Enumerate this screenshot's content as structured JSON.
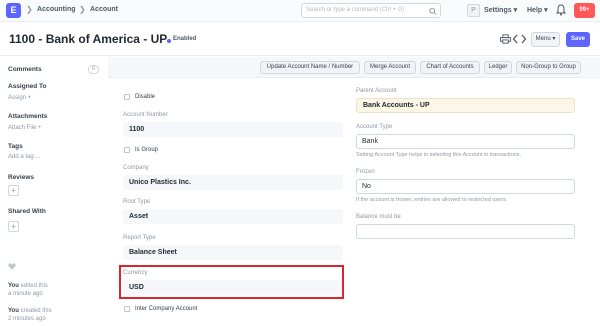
{
  "navbar": {
    "logo": "E",
    "breadcrumbs": [
      "Accounting",
      "Account"
    ],
    "search_placeholder": "Search or type a command (Ctrl + G)",
    "user_initial": "P",
    "settings_label": "Settings",
    "help_label": "Help",
    "notifications_count": "99+"
  },
  "titlebar": {
    "title": "1100 - Bank of America - UP",
    "status": "Enabled",
    "menu_label": "Menu",
    "save_label": "Save"
  },
  "sidebar": {
    "comments_label": "Comments",
    "comments_count": "0",
    "assigned_label": "Assigned To",
    "assign_link": "Assign +",
    "attachments_label": "Attachments",
    "attach_link": "Attach File +",
    "tags_label": "Tags",
    "add_tag_link": "Add a tag ...",
    "reviews_label": "Reviews",
    "shared_label": "Shared With",
    "plus": "+",
    "activity": [
      {
        "who": "You",
        "action": " edited this",
        "when": "a minute ago"
      },
      {
        "who": "You",
        "action": " created this",
        "when": "2 minutes ago"
      }
    ]
  },
  "actions": [
    "Update Account Name / Number",
    "Merge Account",
    "Chart of Accounts",
    "Ledger",
    "Non-Group to Group"
  ],
  "form": {
    "disable_label": "Disable",
    "account_number_label": "Account Number",
    "account_number": "1100",
    "is_group_label": "Is Group",
    "company_label": "Company",
    "company": "Unico Plastics Inc.",
    "root_type_label": "Root Type",
    "root_type": "Asset",
    "report_type_label": "Report Type",
    "report_type": "Balance Sheet",
    "currency_label": "Currency",
    "currency": "USD",
    "inter_company_label": "Inter Company Account",
    "parent_account_label": "Parent Account",
    "parent_account": "Bank Accounts - UP",
    "account_type_label": "Account Type",
    "account_type": "Bank",
    "account_type_help": "Setting Account Type helps in selecting this Account in transactions.",
    "frozen_label": "Frozen",
    "frozen": "No",
    "frozen_help": "If the account is frozen, entries are allowed to restricted users.",
    "balance_label": "Balance must be",
    "balance": ""
  },
  "colors": {
    "brand": "#5e64ff",
    "notification": "#ff5858",
    "highlight": "#d9262c"
  }
}
